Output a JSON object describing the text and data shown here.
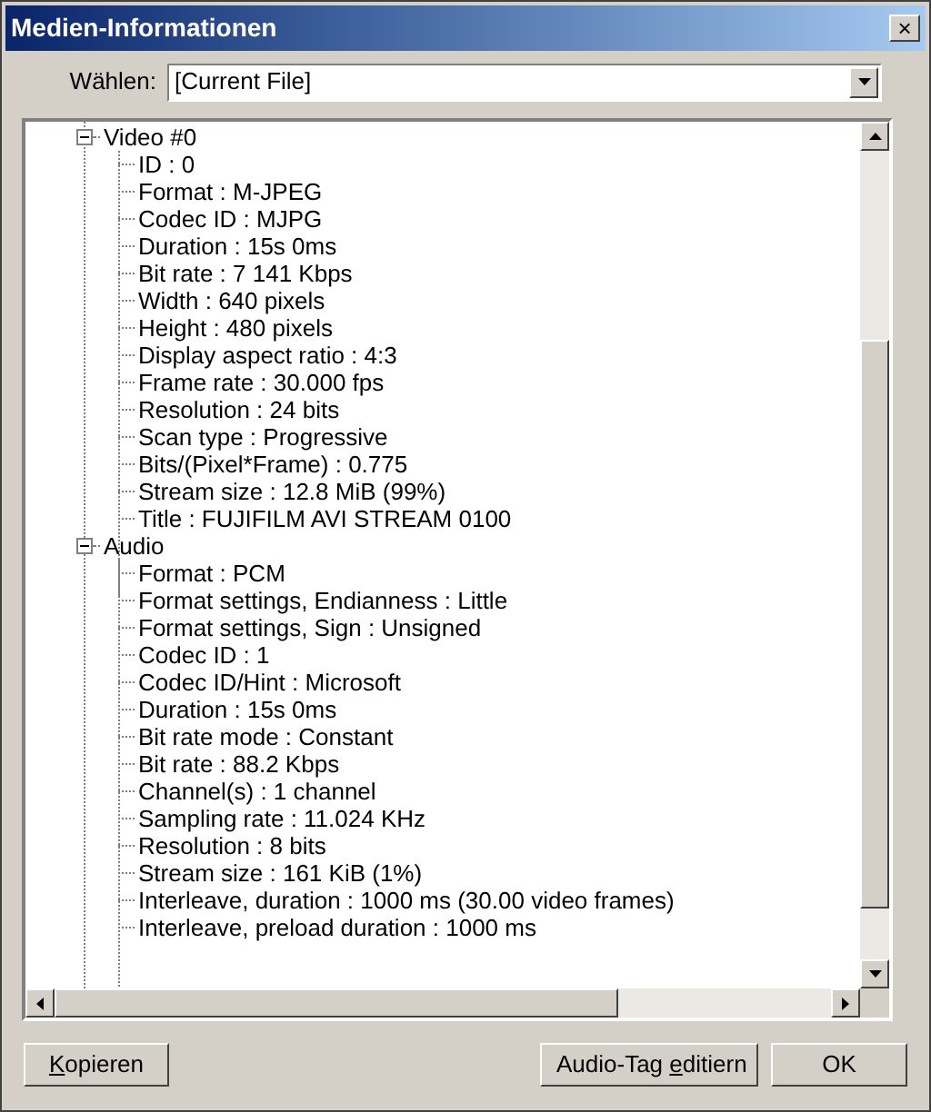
{
  "window": {
    "title": "Medien-Informationen",
    "close": "×"
  },
  "select": {
    "label": "Wählen:",
    "value": "[Current File]"
  },
  "tree": [
    {
      "label": "Video #0",
      "expanded": true,
      "children": [
        {
          "label": "ID : 0"
        },
        {
          "label": "Format : M-JPEG"
        },
        {
          "label": "Codec ID : MJPG"
        },
        {
          "label": "Duration : 15s 0ms"
        },
        {
          "label": "Bit rate : 7 141 Kbps"
        },
        {
          "label": "Width : 640 pixels"
        },
        {
          "label": "Height : 480 pixels"
        },
        {
          "label": "Display aspect ratio : 4:3"
        },
        {
          "label": "Frame rate : 30.000 fps"
        },
        {
          "label": "Resolution : 24 bits"
        },
        {
          "label": "Scan type : Progressive"
        },
        {
          "label": "Bits/(Pixel*Frame) : 0.775"
        },
        {
          "label": "Stream size : 12.8 MiB (99%)"
        },
        {
          "label": "Title : FUJIFILM AVI STREAM 0100"
        }
      ]
    },
    {
      "label": "Audio",
      "expanded": true,
      "children": [
        {
          "label": "Format : PCM"
        },
        {
          "label": "Format settings, Endianness : Little"
        },
        {
          "label": "Format settings, Sign : Unsigned"
        },
        {
          "label": "Codec ID : 1"
        },
        {
          "label": "Codec ID/Hint : Microsoft"
        },
        {
          "label": "Duration : 15s 0ms"
        },
        {
          "label": "Bit rate mode : Constant"
        },
        {
          "label": "Bit rate : 88.2 Kbps"
        },
        {
          "label": "Channel(s) : 1 channel"
        },
        {
          "label": "Sampling rate : 11.024 KHz"
        },
        {
          "label": "Resolution : 8 bits"
        },
        {
          "label": "Stream size : 161 KiB (1%)"
        },
        {
          "label": "Interleave, duration : 1000 ms (30.00 video frames)"
        },
        {
          "label": "Interleave, preload duration : 1000 ms"
        }
      ]
    }
  ],
  "buttons": [
    {
      "kind": "left",
      "key": "K",
      "after": "opieren"
    },
    {
      "kind": "right",
      "before": "Audio-Tag ",
      "key": "e",
      "after": "ditiern"
    },
    {
      "kind": "right",
      "before": "OK"
    }
  ]
}
